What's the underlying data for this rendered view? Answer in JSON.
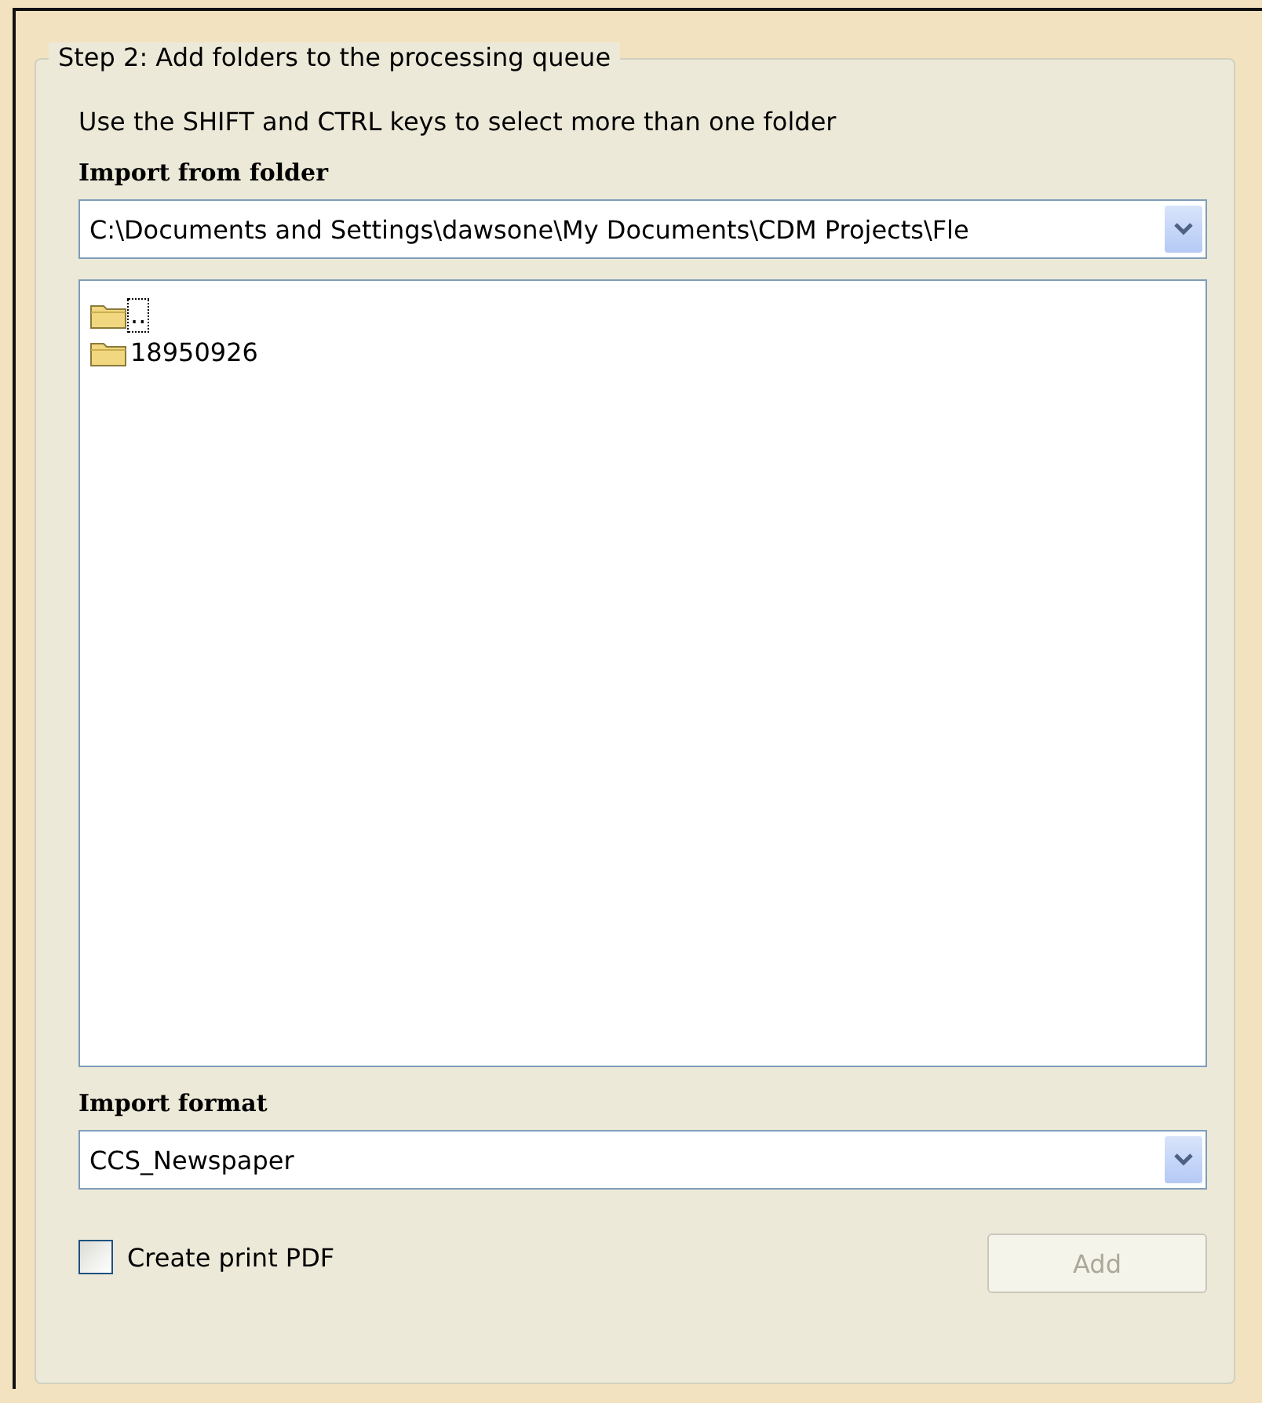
{
  "group": {
    "title": "Step 2: Add folders to the processing queue"
  },
  "hint": "Use the SHIFT and CTRL keys to select more than one folder",
  "import_folder": {
    "label": "Import from folder",
    "value": "C:\\Documents and Settings\\dawsone\\My Documents\\CDM Projects\\Fle"
  },
  "folders": [
    {
      "name": "..",
      "focused": true
    },
    {
      "name": "18950926",
      "focused": false
    }
  ],
  "import_format": {
    "label": "Import format",
    "value": "CCS_Newspaper"
  },
  "create_pdf": {
    "label": "Create print PDF",
    "checked": false
  },
  "add_button": {
    "label": "Add",
    "disabled": true
  }
}
